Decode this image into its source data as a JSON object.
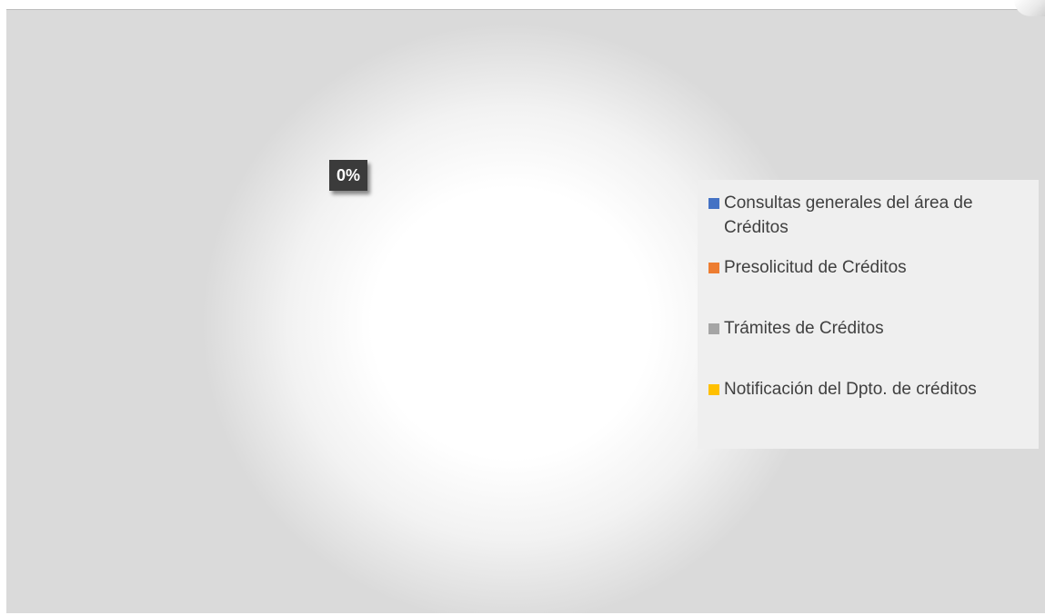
{
  "chart_data": {
    "type": "pie",
    "title": "",
    "categories": [
      "Consultas generales del área de Créditos",
      "Presolicitud de Créditos",
      "Trámites de Créditos",
      "Notificación del Dpto. de créditos"
    ],
    "values": [
      0,
      0,
      0,
      0
    ],
    "data_labels": [
      "0%"
    ],
    "legend_position": "right",
    "colors": [
      "#4472c4",
      "#ed7d31",
      "#a5a5a5",
      "#ffc000"
    ],
    "legend": [
      {
        "label": "Consultas generales del área de Créditos",
        "color": "#4472c4"
      },
      {
        "label": "Presolicitud de Créditos",
        "color": "#ed7d31"
      },
      {
        "label": "Trámites de Créditos",
        "color": "#a5a5a5"
      },
      {
        "label": "Notificación del Dpto. de créditos",
        "color": "#ffc000"
      }
    ]
  }
}
